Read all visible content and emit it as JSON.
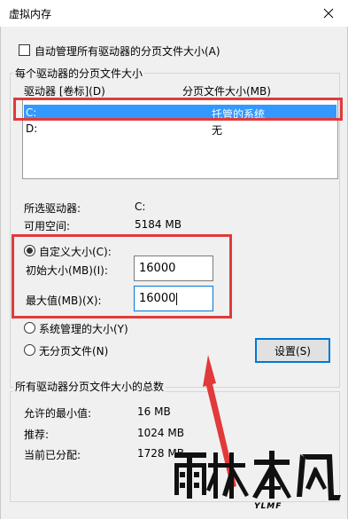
{
  "window": {
    "title": "虚拟内存"
  },
  "auto_manage": {
    "label": "自动管理所有驱动器的分页文件大小(A)",
    "checked": false
  },
  "drives_group": {
    "legend": "每个驱动器的分页文件大小",
    "col_drive": "驱动器 [卷标](D)",
    "col_size": "分页文件大小(MB)",
    "rows": [
      {
        "drive": "C:",
        "size": "托管的系统",
        "selected": true
      },
      {
        "drive": "D:",
        "size": "无",
        "selected": false
      }
    ],
    "selected_drive_label": "所选驱动器:",
    "selected_drive_value": "C:",
    "free_space_label": "可用空间:",
    "free_space_value": "5184 MB",
    "custom_size": {
      "label": "自定义大小(C):",
      "checked": true
    },
    "initial_size": {
      "label": "初始大小(MB)(I):",
      "value": "16000"
    },
    "max_size": {
      "label": "最大值(MB)(X):",
      "value": "16000"
    },
    "system_managed": {
      "label": "系统管理的大小(Y)",
      "checked": false
    },
    "no_paging": {
      "label": "无分页文件(N)",
      "checked": false
    },
    "set_button": "设置(S)"
  },
  "totals_group": {
    "legend": "所有驱动器分页文件大小的总数",
    "min_label": "允许的最小值:",
    "min_value": "16 MB",
    "recommended_label": "推荐:",
    "recommended_value": "1024 MB",
    "allocated_label": "当前已分配:",
    "allocated_value": "1728 MB"
  },
  "watermark": {
    "logo_text": "雨林木风",
    "sub_text": "YLMF"
  },
  "colors": {
    "highlight": "#3399ff",
    "annotation": "#e13a3a",
    "focus": "#0078d7"
  }
}
